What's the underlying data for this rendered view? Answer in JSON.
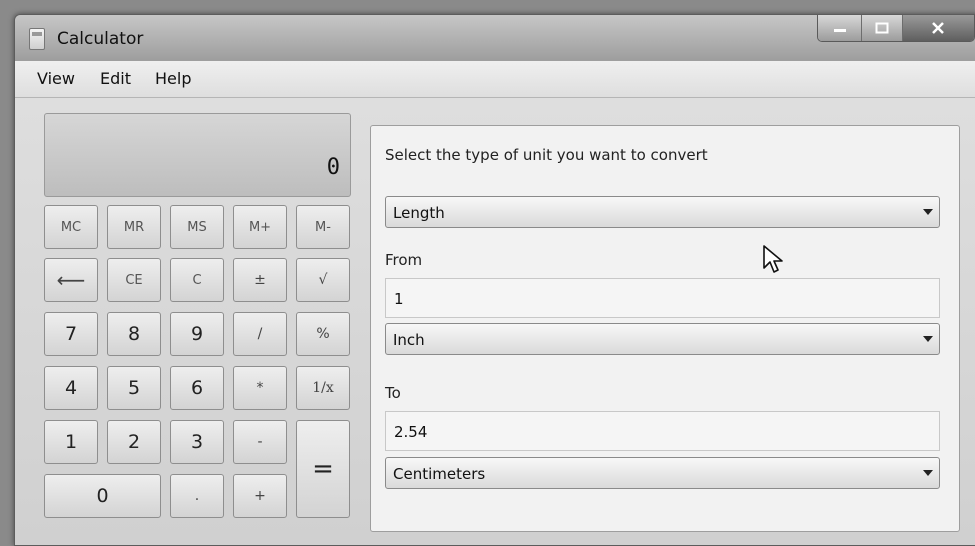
{
  "window": {
    "title": "Calculator"
  },
  "menu": {
    "view": "View",
    "edit": "Edit",
    "help": "Help"
  },
  "display": {
    "value": "0"
  },
  "keys": {
    "mc": "MC",
    "mr": "MR",
    "ms": "MS",
    "mplus": "M+",
    "mminus": "M-",
    "backspace": "⟵",
    "ce": "CE",
    "c": "C",
    "plusminus": "±",
    "sqrt": "√",
    "seven": "7",
    "eight": "8",
    "nine": "9",
    "divide": "/",
    "percent": "%",
    "four": "4",
    "five": "5",
    "six": "6",
    "multiply": "*",
    "reciprocal": "1/x",
    "one": "1",
    "two": "2",
    "three": "3",
    "minus": "-",
    "equals": "=",
    "zero": "0",
    "decimal": ".",
    "plus": "+"
  },
  "converter": {
    "prompt": "Select the type of unit you want to convert",
    "type_selected": "Length",
    "from_label": "From",
    "from_value": "1",
    "from_unit": "Inch",
    "to_label": "To",
    "to_value": "2.54",
    "to_unit": "Centimeters"
  },
  "icons": {
    "app": "calculator-icon",
    "dropdown": "chevron-down-icon",
    "cursor": "mouse-pointer-icon"
  }
}
